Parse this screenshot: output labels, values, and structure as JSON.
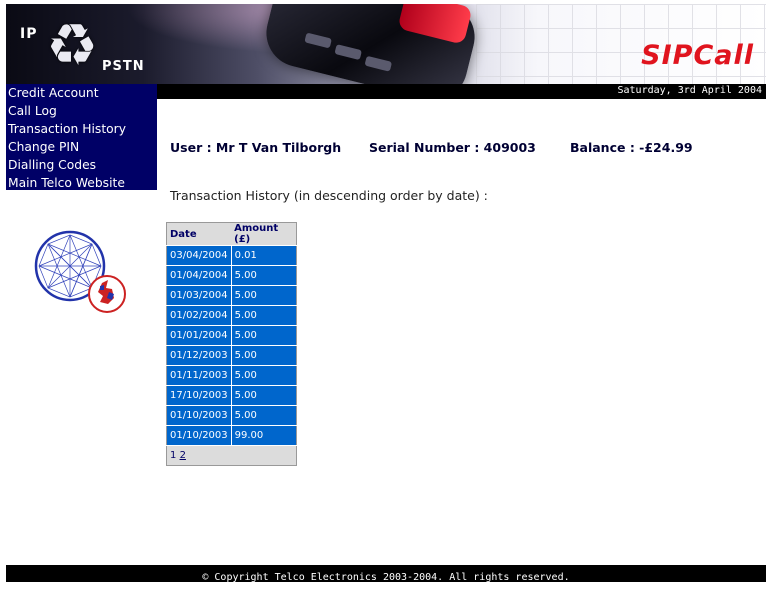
{
  "header": {
    "logo_ip": "IP",
    "logo_pstn": "PSTN",
    "brand": "SIPCall"
  },
  "date_text": "Saturday, 3rd April 2004",
  "menu": [
    "Credit Account",
    "Call Log",
    "Transaction History",
    "Change PIN",
    "Dialling Codes",
    "Main Telco Website"
  ],
  "info": {
    "user": "User : Mr T Van Tilborgh",
    "serial": "Serial Number : 409003",
    "balance": "Balance : -£24.99"
  },
  "heading": "Transaction History (in descending order by date) :",
  "table": {
    "headers": [
      "Date",
      "Amount (£)"
    ],
    "rows": [
      [
        "03/04/2004",
        "0.01"
      ],
      [
        "01/04/2004",
        "5.00"
      ],
      [
        "01/03/2004",
        "5.00"
      ],
      [
        "01/02/2004",
        "5.00"
      ],
      [
        "01/01/2004",
        "5.00"
      ],
      [
        "01/12/2003",
        "5.00"
      ],
      [
        "01/11/2003",
        "5.00"
      ],
      [
        "17/10/2003",
        "5.00"
      ],
      [
        "01/10/2003",
        "5.00"
      ],
      [
        "01/10/2003",
        "99.00"
      ]
    ],
    "pager": [
      "1",
      "2"
    ]
  },
  "footer": "© Copyright Telco Electronics 2003-2004. All rights reserved.",
  "icons": {
    "recycle": "recycle-icon",
    "logo": "globe-network-logo"
  },
  "colors": {
    "menu_bg": "#000066",
    "cell_bg": "#0066cc",
    "brand_red": "#e0141e"
  }
}
